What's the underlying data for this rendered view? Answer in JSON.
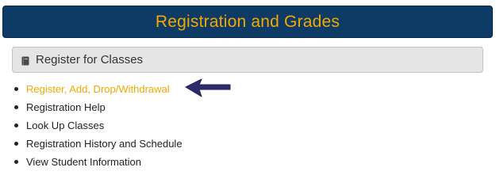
{
  "header": {
    "title": "Registration and Grades"
  },
  "section": {
    "icon": "book-icon",
    "title": "Register for Classes"
  },
  "links": [
    {
      "label": "Register, Add, Drop/Withdrawal",
      "active": true
    },
    {
      "label": "Registration Help"
    },
    {
      "label": "Look Up Classes"
    },
    {
      "label": "Registration History and Schedule"
    },
    {
      "label": "View Student Information"
    }
  ],
  "annotation": {
    "icon": "pointer-arrow-icon",
    "color": "#2e2a6e"
  },
  "colors": {
    "banner_background": "#0e3a66",
    "accent": "#f2a900",
    "panel_background": "#e5e5e5"
  }
}
